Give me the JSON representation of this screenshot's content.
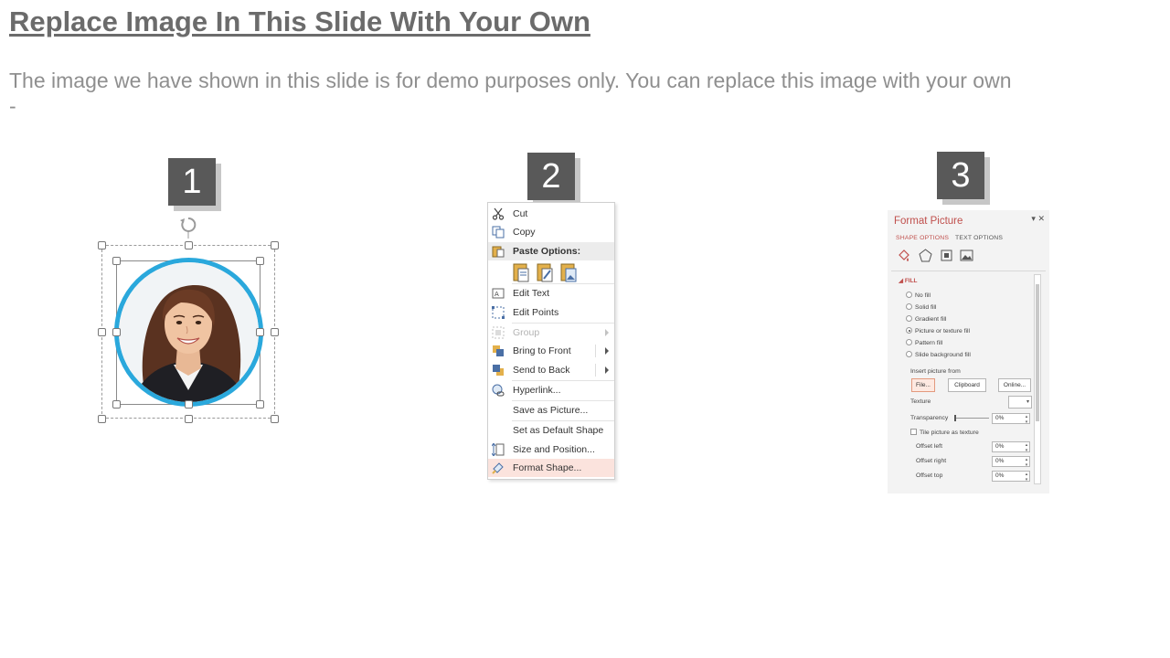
{
  "slide": {
    "title": "Replace Image In This Slide With Your Own",
    "subtitle": "The image we have shown in this slide is for demo purposes only. You can replace this image with your own -"
  },
  "steps": [
    {
      "number": "1"
    },
    {
      "number": "2"
    },
    {
      "number": "3"
    }
  ],
  "context_menu": {
    "items": [
      {
        "label": "Cut",
        "icon": "scissors-icon",
        "enabled": true
      },
      {
        "label": "Copy",
        "icon": "copy-icon",
        "enabled": true
      },
      {
        "label": "Paste Options:",
        "icon": "paste-icon",
        "enabled": true
      },
      {
        "label": "Edit Text",
        "icon": "edit-text-icon",
        "enabled": true
      },
      {
        "label": "Edit Points",
        "icon": "edit-points-icon",
        "enabled": true
      },
      {
        "label": "Group",
        "icon": "group-icon",
        "enabled": false
      },
      {
        "label": "Bring to Front",
        "icon": "bring-front-icon",
        "enabled": true
      },
      {
        "label": "Send to Back",
        "icon": "send-back-icon",
        "enabled": true
      },
      {
        "label": "Hyperlink...",
        "icon": "hyperlink-icon",
        "enabled": true
      },
      {
        "label": "Save as Picture...",
        "icon": "",
        "enabled": true
      },
      {
        "label": "Set as Default Shape",
        "icon": "",
        "enabled": true
      },
      {
        "label": "Size and Position...",
        "icon": "size-position-icon",
        "enabled": true
      },
      {
        "label": "Format Shape...",
        "icon": "format-shape-icon",
        "enabled": true,
        "highlighted": true
      }
    ]
  },
  "format_pane": {
    "title": "Format Picture",
    "tabs": [
      "SHAPE OPTIONS",
      "TEXT OPTIONS"
    ],
    "section": "FILL",
    "fill_options": [
      {
        "label": "No fill",
        "selected": false
      },
      {
        "label": "Solid fill",
        "selected": false
      },
      {
        "label": "Gradient fill",
        "selected": false
      },
      {
        "label": "Picture or texture fill",
        "selected": true
      },
      {
        "label": "Pattern fill",
        "selected": false
      },
      {
        "label": "Slide background fill",
        "selected": false
      }
    ],
    "insert_from_label": "Insert picture from",
    "buttons": [
      "File...",
      "Clipboard",
      "Online..."
    ],
    "texture_label": "Texture",
    "transparency_label": "Transparency",
    "transparency_value": "0%",
    "tile_label": "Tile picture as texture",
    "offsets": [
      {
        "label": "Offset left",
        "value": "0%"
      },
      {
        "label": "Offset right",
        "value": "0%"
      },
      {
        "label": "Offset top",
        "value": "0%"
      }
    ],
    "accent_color": "#c0504d"
  }
}
